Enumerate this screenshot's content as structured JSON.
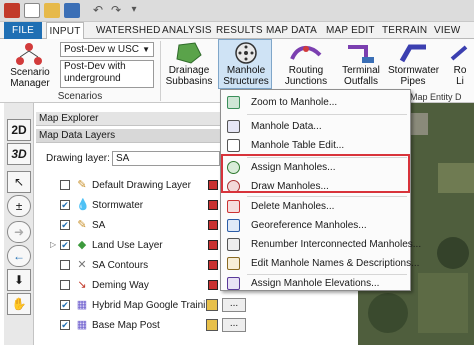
{
  "quick_access": {
    "icons": [
      "app-logo-icon",
      "new-file-icon",
      "open-folder-icon",
      "save-icon",
      "undo-icon",
      "redo-icon",
      "more-icon"
    ]
  },
  "tabs": [
    "FILE",
    "INPUT",
    "WATERSHED",
    "ANALYSIS",
    "RESULTS",
    "MAP DATA",
    "MAP EDIT",
    "TERRAIN",
    "VIEW"
  ],
  "ribbon": {
    "scenario_manager_label": "Scenario\nManager",
    "scenario_combo": "Post-Dev w USC",
    "scenario_desc": "Post-Dev with\nunderground",
    "group_scenarios": "Scenarios",
    "buttons": [
      {
        "label": "Drainage\nSubbasins"
      },
      {
        "label": "Manhole\nStructures"
      },
      {
        "label": "Routing\nJunctions"
      },
      {
        "label": "Terminal\nOutfalls"
      },
      {
        "label": "Stormwater\nPipes"
      },
      {
        "label": "Ro\nLi"
      }
    ],
    "map_entity_partial": "Map Entity D"
  },
  "left_toolbar": {
    "btn_2d": "2D",
    "btn_3d": "3D"
  },
  "explorer": {
    "title": "Map Explorer",
    "layers_title": "Map Data Layers",
    "drawing_layer_label": "Drawing layer:",
    "drawing_layer_value": "SA",
    "layers": [
      {
        "name": "Default Drawing Layer",
        "checked": false,
        "icon": "pen-icon"
      },
      {
        "name": "Stormwater",
        "checked": true,
        "icon": "water-drop-icon"
      },
      {
        "name": "SA",
        "checked": true,
        "icon": "pen-icon"
      },
      {
        "name": "Land Use Layer",
        "checked": true,
        "icon": "landuse-icon"
      },
      {
        "name": "SA Contours",
        "checked": false,
        "icon": "contours-icon"
      },
      {
        "name": "Deming Way",
        "checked": false,
        "icon": "road-icon"
      },
      {
        "name": "Hybrid Map Google Training",
        "checked": true,
        "icon": "map-icon"
      },
      {
        "name": "Base Map Post",
        "checked": true,
        "icon": "map-icon"
      }
    ]
  },
  "menu": {
    "items": [
      {
        "label": "Zoom to Manhole...",
        "icon": "zoom-manhole-icon"
      },
      {
        "label": "Manhole Data...",
        "icon": "manhole-data-icon"
      },
      {
        "label": "Manhole Table Edit...",
        "icon": "table-edit-icon"
      },
      {
        "label": "Assign Manholes...",
        "icon": "assign-manhole-icon"
      },
      {
        "label": "Draw Manholes...",
        "icon": "draw-manhole-icon"
      },
      {
        "label": "Delete Manholes...",
        "icon": "delete-manhole-icon"
      },
      {
        "label": "Georeference Manholes...",
        "icon": "georeference-icon"
      },
      {
        "label": "Renumber Interconnected Manholes...",
        "icon": "renumber-icon"
      },
      {
        "label": "Edit Manhole Names & Descriptions...",
        "icon": "edit-names-icon"
      },
      {
        "label": "Assign Manhole Elevations...",
        "icon": "elevation-icon"
      }
    ]
  },
  "colors": {
    "file_tab": "#1f6fb4",
    "highlight": "#d8333a",
    "layer_style": "#c83232"
  }
}
